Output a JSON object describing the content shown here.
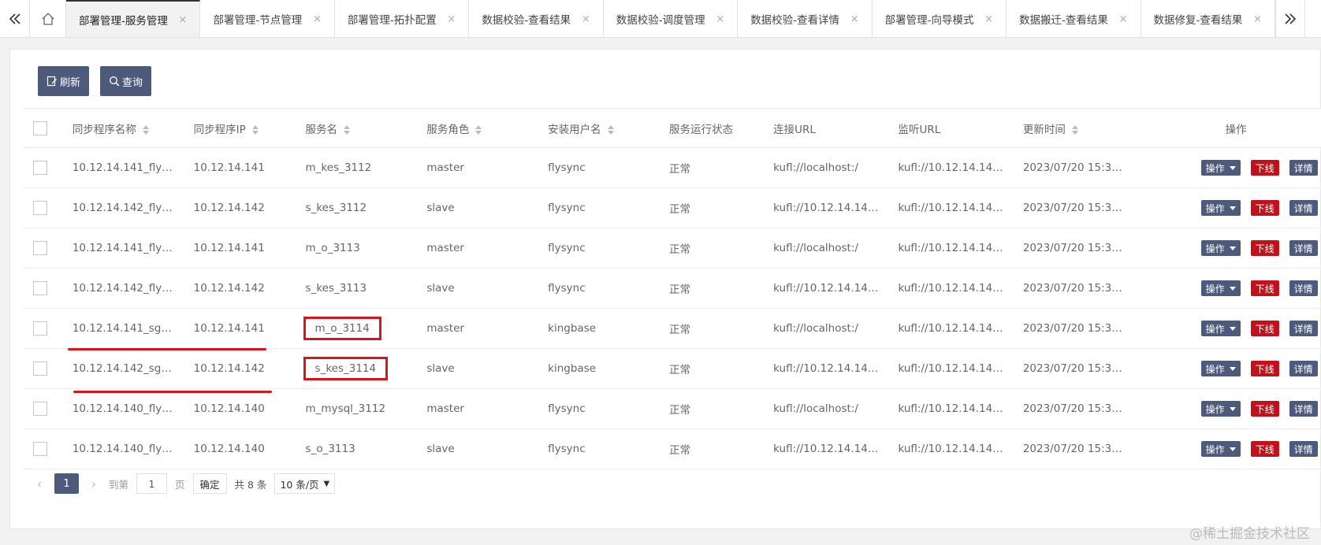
{
  "tabbar": {
    "left_icon": "double-chevron-left-icon",
    "home_icon": "home-icon",
    "right_icon": "double-chevron-right-icon",
    "tabs": [
      {
        "label": "部署管理-服务管理",
        "active": true
      },
      {
        "label": "部署管理-节点管理",
        "active": false
      },
      {
        "label": "部署管理-拓扑配置",
        "active": false
      },
      {
        "label": "数据校验-查看结果",
        "active": false
      },
      {
        "label": "数据校验-调度管理",
        "active": false
      },
      {
        "label": "数据校验-查看详情",
        "active": false
      },
      {
        "label": "部署管理-向导模式",
        "active": false
      },
      {
        "label": "数据搬迁-查看结果",
        "active": false
      },
      {
        "label": "数据修复-查看结果",
        "active": false
      }
    ],
    "close_glyph": "×"
  },
  "toolbar": {
    "refresh_label": "刷新",
    "query_label": "查询"
  },
  "table": {
    "headers": [
      "同步程序名称",
      "同步程序IP",
      "服务名",
      "服务角色",
      "安装用户名",
      "服务运行状态",
      "连接URL",
      "监听URL",
      "更新时间",
      "操作"
    ],
    "rows": [
      [
        "10.12.14.141_fly…",
        "10.12.14.141",
        "m_kes_3112",
        "master",
        "flysync",
        "正常",
        "kufl://localhost:/",
        "kufl://10.12.14.14…",
        "2023/07/20 15:3…"
      ],
      [
        "10.12.14.142_fly…",
        "10.12.14.142",
        "s_kes_3112",
        "slave",
        "flysync",
        "正常",
        "kufl://10.12.14.14…",
        "kufl://10.12.14.14…",
        "2023/07/20 15:3…"
      ],
      [
        "10.12.14.141_fly…",
        "10.12.14.141",
        "m_o_3113",
        "master",
        "flysync",
        "正常",
        "kufl://localhost:/",
        "kufl://10.12.14.14…",
        "2023/07/20 15:3…"
      ],
      [
        "10.12.14.142_fly…",
        "10.12.14.142",
        "s_kes_3113",
        "slave",
        "flysync",
        "正常",
        "kufl://10.12.14.14…",
        "kufl://10.12.14.14…",
        "2023/07/20 15:3…"
      ],
      [
        "10.12.14.141_sg…",
        "10.12.14.141",
        "m_o_3114",
        "master",
        "kingbase",
        "正常",
        "kufl://localhost:/",
        "kufl://10.12.14.14…",
        "2023/07/20 15:3…"
      ],
      [
        "10.12.14.142_sg…",
        "10.12.14.142",
        "s_kes_3114",
        "slave",
        "kingbase",
        "正常",
        "kufl://10.12.14.14…",
        "kufl://10.12.14.14…",
        "2023/07/20 15:3…"
      ],
      [
        "10.12.14.140_fly…",
        "10.12.14.140",
        "m_mysql_3112",
        "master",
        "flysync",
        "正常",
        "kufl://localhost:/",
        "kufl://10.12.14.14…",
        "2023/07/20 15:3…"
      ],
      [
        "10.12.14.140_fly…",
        "10.12.14.140",
        "s_o_3113",
        "slave",
        "flysync",
        "正常",
        "kufl://10.12.14.14…",
        "kufl://10.12.14.14…",
        "2023/07/20 15:3…"
      ]
    ],
    "op_label": "操作",
    "offline_label": "下线",
    "detail_label": "详情"
  },
  "pager": {
    "current_page": "1",
    "goto_label": "到第",
    "goto_value": "1",
    "page_unit": "页",
    "confirm_label": "确定",
    "total_label": "共 8 条",
    "page_size": "10 条/页"
  },
  "watermark": "@稀土掘金技术社区",
  "colors": {
    "primary": "#4e5a7c",
    "danger": "#c1121c",
    "annotation": "#d9141f"
  }
}
